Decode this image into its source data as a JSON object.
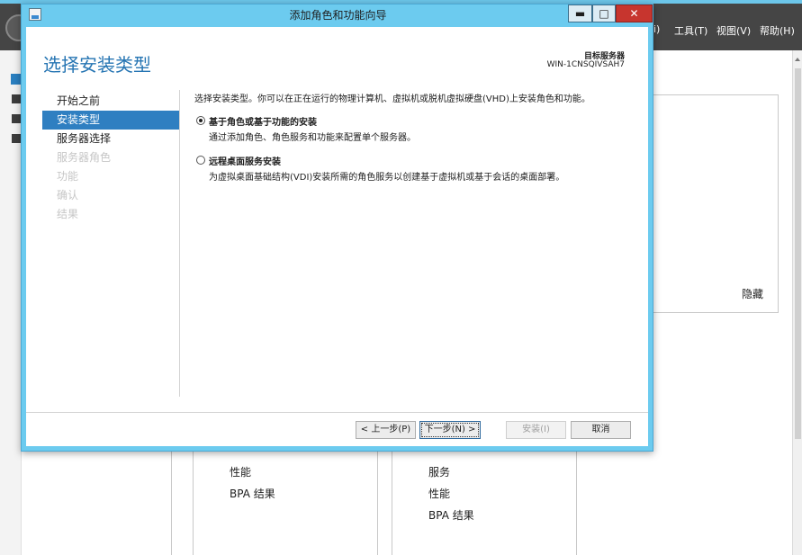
{
  "server_manager": {
    "menu": {
      "partial": "i)",
      "tools": "工具(T)",
      "view": "视图(V)",
      "help": "帮助(H)"
    },
    "panel": {
      "hide_label": "隐藏"
    },
    "tiles": [
      {
        "items": [
          "性能",
          "BPA 结果"
        ]
      },
      {
        "items": [
          "服务",
          "性能",
          "BPA 结果"
        ]
      }
    ]
  },
  "wizard": {
    "window_title": "添加角色和功能向导",
    "controls": {
      "minimize": "▬",
      "maximize": "□",
      "close": "✕"
    },
    "heading": "选择安装类型",
    "target_label": "目标服务器",
    "target_value": "WIN-1CNSQIVSAH7",
    "nav": [
      {
        "label": "开始之前",
        "state": "normal"
      },
      {
        "label": "安装类型",
        "state": "active"
      },
      {
        "label": "服务器选择",
        "state": "normal"
      },
      {
        "label": "服务器角色",
        "state": "disabled"
      },
      {
        "label": "功能",
        "state": "disabled"
      },
      {
        "label": "确认",
        "state": "disabled"
      },
      {
        "label": "结果",
        "state": "disabled"
      }
    ],
    "intro": "选择安装类型。你可以在正在运行的物理计算机、虚拟机或脱机虚拟硬盘(VHD)上安装角色和功能。",
    "options": [
      {
        "title": "基于角色或基于功能的安装",
        "desc": "通过添加角色、角色服务和功能来配置单个服务器。",
        "checked": true
      },
      {
        "title": "远程桌面服务安装",
        "desc": "为虚拟桌面基础结构(VDI)安装所需的角色服务以创建基于虚拟机或基于会话的桌面部署。",
        "checked": false
      }
    ],
    "buttons": {
      "prev": "< 上一步(P)",
      "next": "下一步(N) >",
      "install": "安装(I)",
      "cancel": "取消"
    }
  }
}
